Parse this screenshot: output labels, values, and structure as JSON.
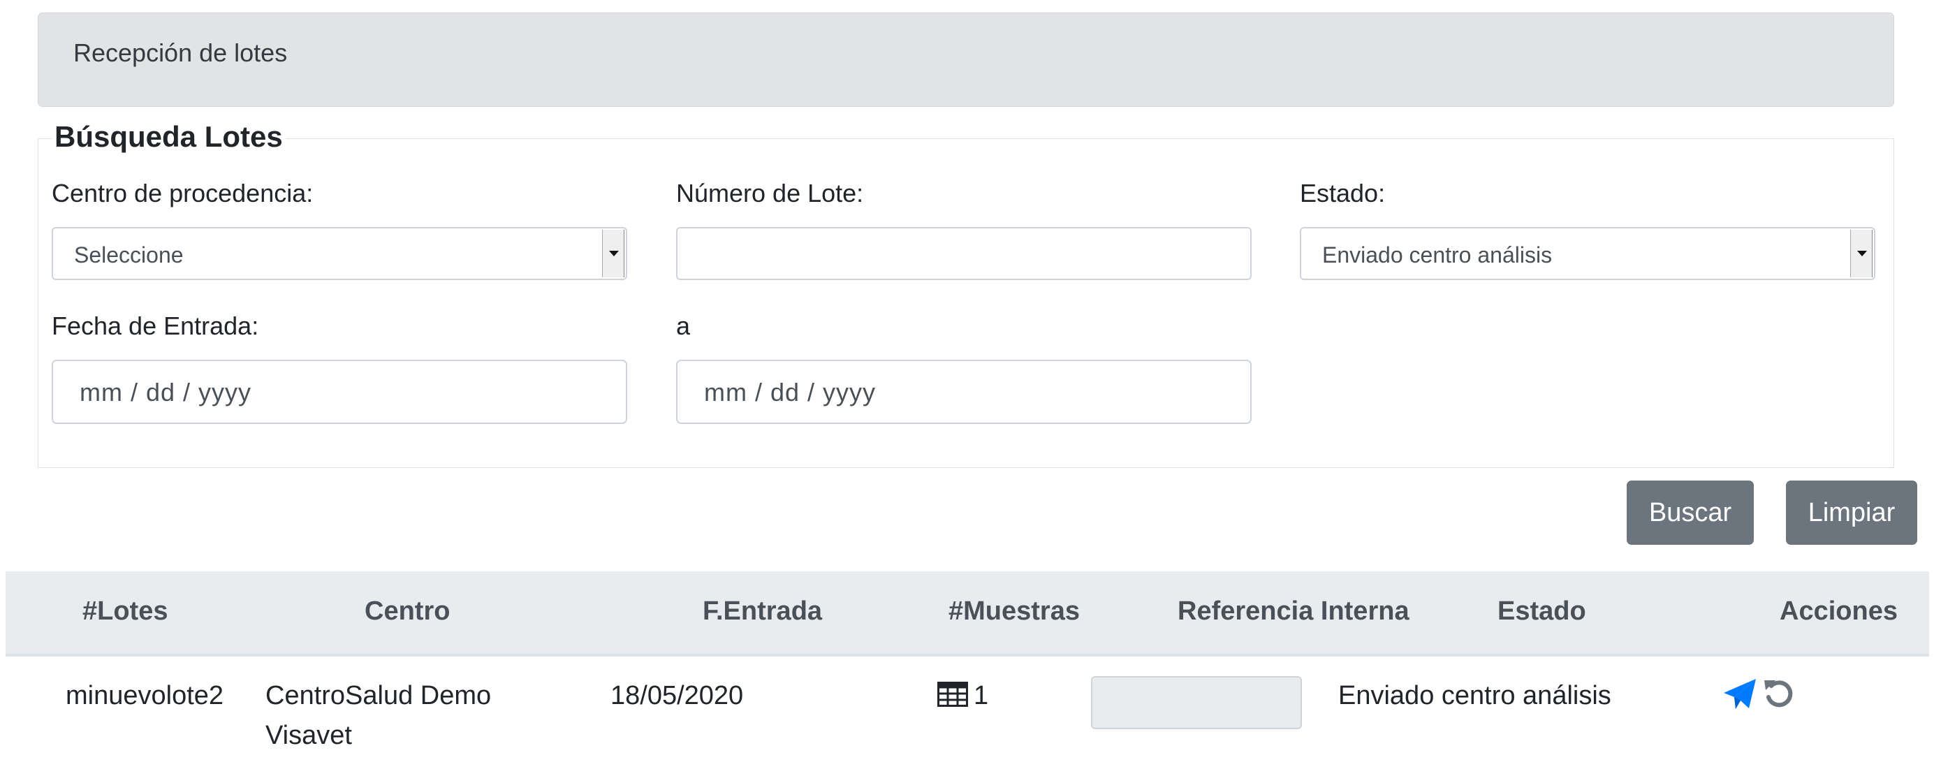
{
  "header": {
    "title": "Recepción de lotes"
  },
  "search": {
    "legend": "Búsqueda Lotes",
    "centro_label": "Centro de procedencia:",
    "centro_value": "Seleccione",
    "lote_label": "Número de Lote:",
    "lote_value": "",
    "estado_label": "Estado:",
    "estado_value": "Enviado centro análisis",
    "fecha_label": "Fecha de Entrada:",
    "fecha_to_label": "a",
    "fecha_from_placeholder": "mm / dd / yyyy",
    "fecha_to_placeholder": "mm / dd / yyyy"
  },
  "buttons": {
    "search": "Buscar",
    "clear": "Limpiar"
  },
  "table": {
    "headers": [
      "#Lotes",
      "Centro",
      "F.Entrada",
      "#Muestras",
      "Referencia Interna",
      "Estado",
      "Acciones"
    ],
    "rows": [
      {
        "lote": "minuevolote2",
        "centro_line1": "CentroSalud Demo",
        "centro_line2": "Visavet",
        "fecha": "18/05/2020",
        "muestras": "1",
        "referencia": "",
        "estado": "Enviado centro análisis"
      }
    ]
  },
  "icons": {
    "muestras": "table-icon",
    "send": "paper-plane-icon",
    "undo": "undo-icon"
  },
  "colors": {
    "accent": "#007bff",
    "button": "#6c757d",
    "header_bg": "#e2e3e5"
  }
}
